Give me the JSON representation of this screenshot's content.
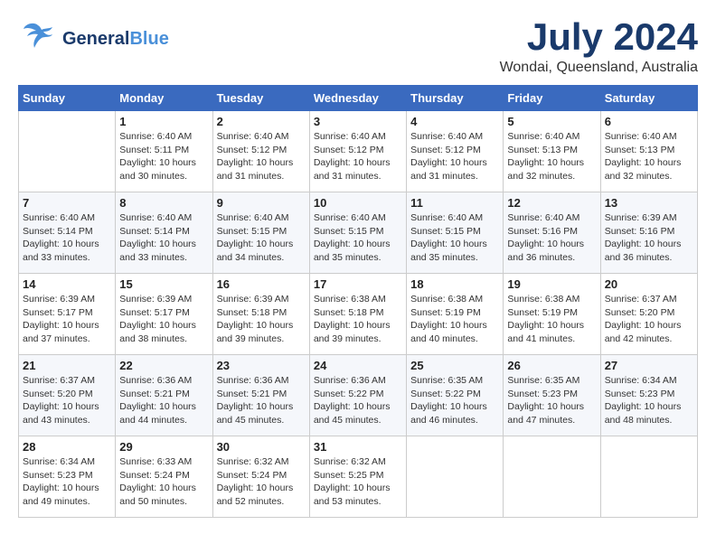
{
  "header": {
    "logo_general": "General",
    "logo_blue": "Blue",
    "month_year": "July 2024",
    "location": "Wondai, Queensland, Australia"
  },
  "weekdays": [
    "Sunday",
    "Monday",
    "Tuesday",
    "Wednesday",
    "Thursday",
    "Friday",
    "Saturday"
  ],
  "weeks": [
    [
      {
        "day": "",
        "info": ""
      },
      {
        "day": "1",
        "info": "Sunrise: 6:40 AM\nSunset: 5:11 PM\nDaylight: 10 hours\nand 30 minutes."
      },
      {
        "day": "2",
        "info": "Sunrise: 6:40 AM\nSunset: 5:12 PM\nDaylight: 10 hours\nand 31 minutes."
      },
      {
        "day": "3",
        "info": "Sunrise: 6:40 AM\nSunset: 5:12 PM\nDaylight: 10 hours\nand 31 minutes."
      },
      {
        "day": "4",
        "info": "Sunrise: 6:40 AM\nSunset: 5:12 PM\nDaylight: 10 hours\nand 31 minutes."
      },
      {
        "day": "5",
        "info": "Sunrise: 6:40 AM\nSunset: 5:13 PM\nDaylight: 10 hours\nand 32 minutes."
      },
      {
        "day": "6",
        "info": "Sunrise: 6:40 AM\nSunset: 5:13 PM\nDaylight: 10 hours\nand 32 minutes."
      }
    ],
    [
      {
        "day": "7",
        "info": "Sunrise: 6:40 AM\nSunset: 5:14 PM\nDaylight: 10 hours\nand 33 minutes."
      },
      {
        "day": "8",
        "info": "Sunrise: 6:40 AM\nSunset: 5:14 PM\nDaylight: 10 hours\nand 33 minutes."
      },
      {
        "day": "9",
        "info": "Sunrise: 6:40 AM\nSunset: 5:15 PM\nDaylight: 10 hours\nand 34 minutes."
      },
      {
        "day": "10",
        "info": "Sunrise: 6:40 AM\nSunset: 5:15 PM\nDaylight: 10 hours\nand 35 minutes."
      },
      {
        "day": "11",
        "info": "Sunrise: 6:40 AM\nSunset: 5:15 PM\nDaylight: 10 hours\nand 35 minutes."
      },
      {
        "day": "12",
        "info": "Sunrise: 6:40 AM\nSunset: 5:16 PM\nDaylight: 10 hours\nand 36 minutes."
      },
      {
        "day": "13",
        "info": "Sunrise: 6:39 AM\nSunset: 5:16 PM\nDaylight: 10 hours\nand 36 minutes."
      }
    ],
    [
      {
        "day": "14",
        "info": "Sunrise: 6:39 AM\nSunset: 5:17 PM\nDaylight: 10 hours\nand 37 minutes."
      },
      {
        "day": "15",
        "info": "Sunrise: 6:39 AM\nSunset: 5:17 PM\nDaylight: 10 hours\nand 38 minutes."
      },
      {
        "day": "16",
        "info": "Sunrise: 6:39 AM\nSunset: 5:18 PM\nDaylight: 10 hours\nand 39 minutes."
      },
      {
        "day": "17",
        "info": "Sunrise: 6:38 AM\nSunset: 5:18 PM\nDaylight: 10 hours\nand 39 minutes."
      },
      {
        "day": "18",
        "info": "Sunrise: 6:38 AM\nSunset: 5:19 PM\nDaylight: 10 hours\nand 40 minutes."
      },
      {
        "day": "19",
        "info": "Sunrise: 6:38 AM\nSunset: 5:19 PM\nDaylight: 10 hours\nand 41 minutes."
      },
      {
        "day": "20",
        "info": "Sunrise: 6:37 AM\nSunset: 5:20 PM\nDaylight: 10 hours\nand 42 minutes."
      }
    ],
    [
      {
        "day": "21",
        "info": "Sunrise: 6:37 AM\nSunset: 5:20 PM\nDaylight: 10 hours\nand 43 minutes."
      },
      {
        "day": "22",
        "info": "Sunrise: 6:36 AM\nSunset: 5:21 PM\nDaylight: 10 hours\nand 44 minutes."
      },
      {
        "day": "23",
        "info": "Sunrise: 6:36 AM\nSunset: 5:21 PM\nDaylight: 10 hours\nand 45 minutes."
      },
      {
        "day": "24",
        "info": "Sunrise: 6:36 AM\nSunset: 5:22 PM\nDaylight: 10 hours\nand 45 minutes."
      },
      {
        "day": "25",
        "info": "Sunrise: 6:35 AM\nSunset: 5:22 PM\nDaylight: 10 hours\nand 46 minutes."
      },
      {
        "day": "26",
        "info": "Sunrise: 6:35 AM\nSunset: 5:23 PM\nDaylight: 10 hours\nand 47 minutes."
      },
      {
        "day": "27",
        "info": "Sunrise: 6:34 AM\nSunset: 5:23 PM\nDaylight: 10 hours\nand 48 minutes."
      }
    ],
    [
      {
        "day": "28",
        "info": "Sunrise: 6:34 AM\nSunset: 5:23 PM\nDaylight: 10 hours\nand 49 minutes."
      },
      {
        "day": "29",
        "info": "Sunrise: 6:33 AM\nSunset: 5:24 PM\nDaylight: 10 hours\nand 50 minutes."
      },
      {
        "day": "30",
        "info": "Sunrise: 6:32 AM\nSunset: 5:24 PM\nDaylight: 10 hours\nand 52 minutes."
      },
      {
        "day": "31",
        "info": "Sunrise: 6:32 AM\nSunset: 5:25 PM\nDaylight: 10 hours\nand 53 minutes."
      },
      {
        "day": "",
        "info": ""
      },
      {
        "day": "",
        "info": ""
      },
      {
        "day": "",
        "info": ""
      }
    ]
  ]
}
